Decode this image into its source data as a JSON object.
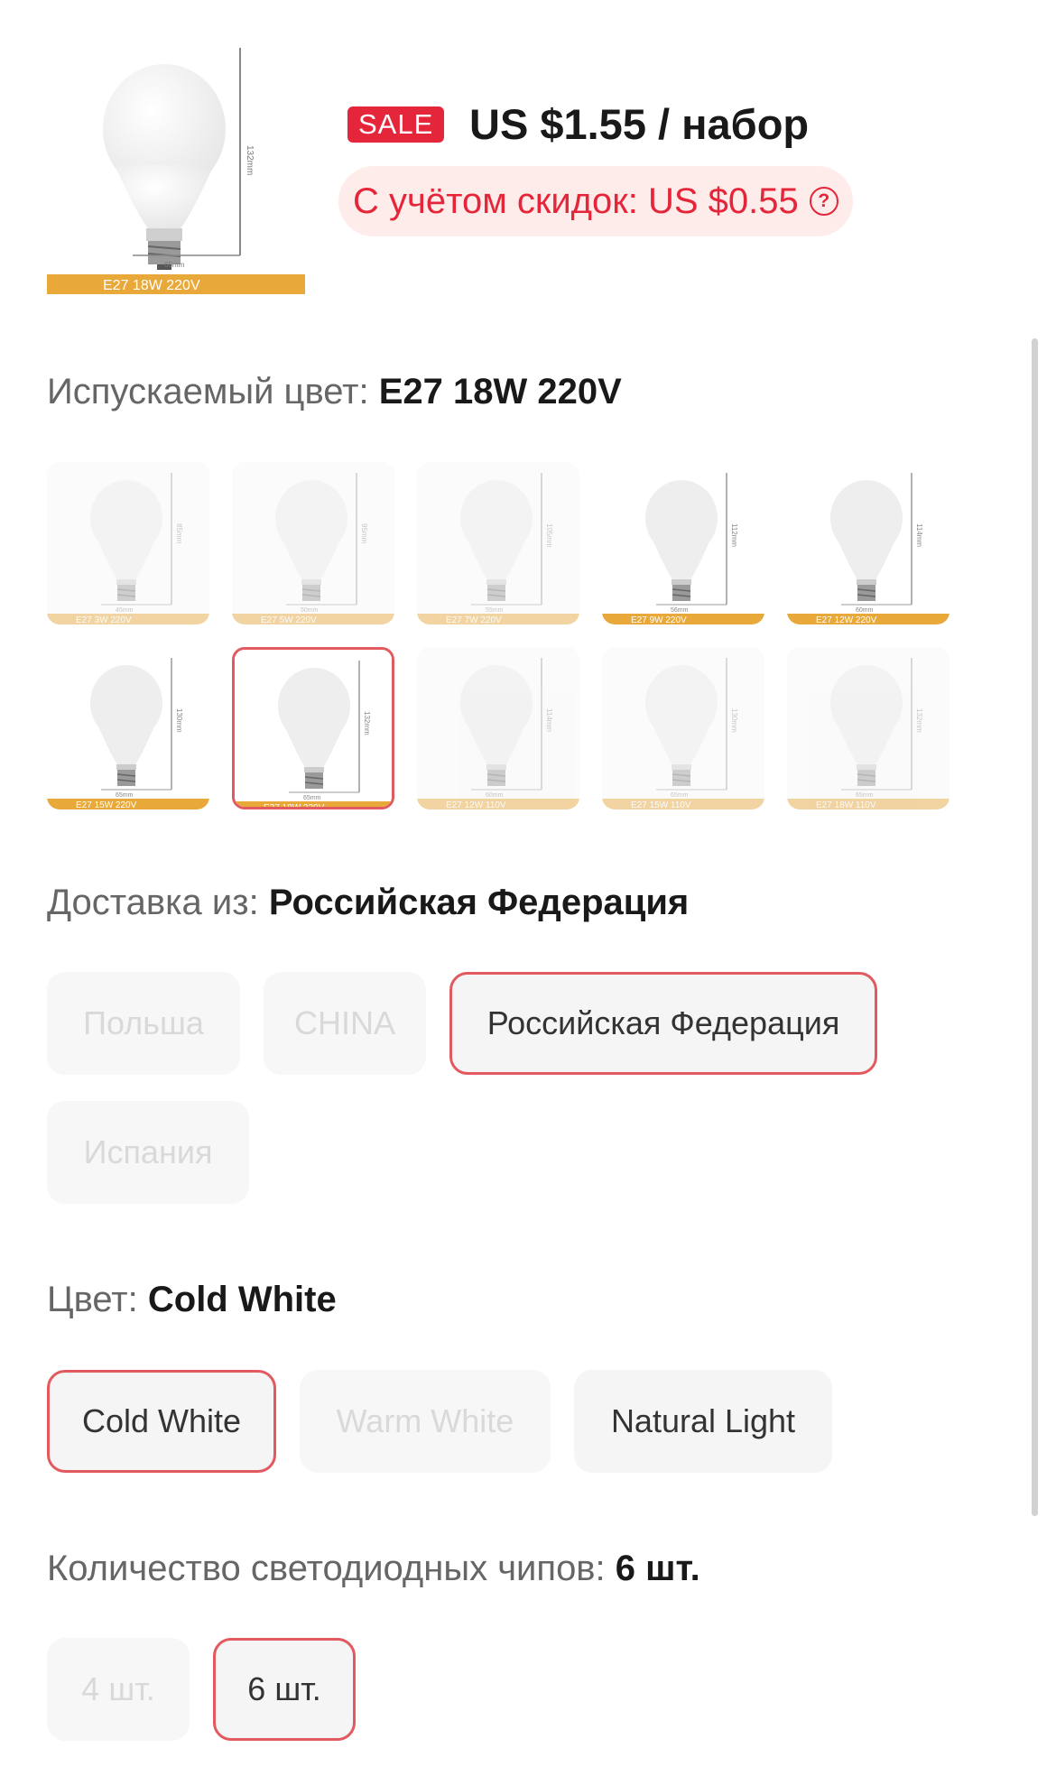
{
  "header": {
    "sale_badge": "SALE",
    "price": "US $1.55 / набор",
    "discount_price": "С учётом скидок: US $0.55",
    "help_glyph": "?",
    "main_image_caption": "E27   18W   220V",
    "main_image_dims": [
      "132mm",
      "65mm"
    ]
  },
  "color_section": {
    "label": "Испускаемый цвет:",
    "selected": "E27 18W 220V",
    "options": [
      {
        "caption": "E27   3W   220V",
        "dim": "45mm",
        "height": "85mm",
        "available": false
      },
      {
        "caption": "E27   5W   220V",
        "dim": "50mm",
        "height": "95mm",
        "available": false
      },
      {
        "caption": "E27   7W   220V",
        "dim": "55mm",
        "height": "105mm",
        "available": false
      },
      {
        "caption": "E27   9W   220V",
        "dim": "56mm",
        "height": "112mm",
        "available": true
      },
      {
        "caption": "E27   12W   220V",
        "dim": "60mm",
        "height": "114mm",
        "available": true
      },
      {
        "caption": "E27   15W   220V",
        "dim": "65mm",
        "height": "130mm",
        "available": true
      },
      {
        "caption": "E27   18W   220V",
        "dim": "65mm",
        "height": "132mm",
        "available": true,
        "selected": true
      },
      {
        "caption": "E27   12W   110V",
        "dim": "60mm",
        "height": "114mm",
        "available": false
      },
      {
        "caption": "E27   15W   110V",
        "dim": "65mm",
        "height": "130mm",
        "available": false
      },
      {
        "caption": "E27   18W   110V",
        "dim": "65mm",
        "height": "132mm",
        "available": false
      }
    ]
  },
  "ship_from": {
    "label": "Доставка из:",
    "selected": "Российская Федерация",
    "options": [
      "Польша",
      "CHINA",
      "Российская Федерация",
      "Испания"
    ]
  },
  "light_color": {
    "label": "Цвет:",
    "selected": "Cold White",
    "options": [
      "Cold White",
      "Warm White",
      "Natural Light"
    ]
  },
  "led_chips": {
    "label": "Количество светодиодных чипов:",
    "selected": "6 шт.",
    "options": [
      "4 шт.",
      "6 шт."
    ]
  },
  "colors": {
    "accent": "#e5263a",
    "selected_border": "#e25a5f",
    "pill_bg": "#fdecea",
    "caption_bar": "#e8a93a"
  }
}
